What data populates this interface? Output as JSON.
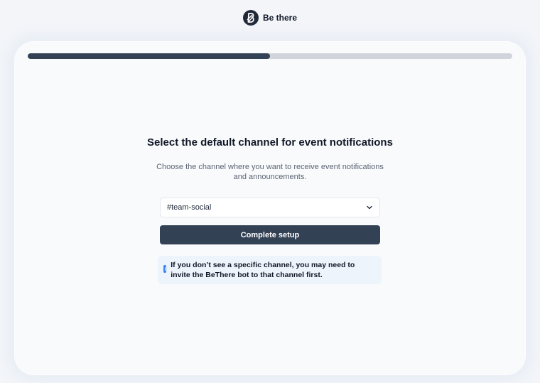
{
  "brand": {
    "name": "Be there",
    "logo_icon": "bethere-logo-icon"
  },
  "progress": {
    "fraction": 0.5
  },
  "step": {
    "title": "Select the default channel for event notifications",
    "subtitle": "Choose the channel where you want to receive event notifications and announcements."
  },
  "channel_select": {
    "value": "#team-social",
    "icon": "chevron-down-icon"
  },
  "complete_button": {
    "label": "Complete setup"
  },
  "info_note": {
    "icon": "info-icon",
    "text": "If you don’t see a specific channel, you may need to invite the BeThere bot to that channel first."
  },
  "colors": {
    "accent": "#334155",
    "track": "#d1d5db",
    "info_bg": "#eef4fb",
    "info_icon": "#3b82f6"
  }
}
